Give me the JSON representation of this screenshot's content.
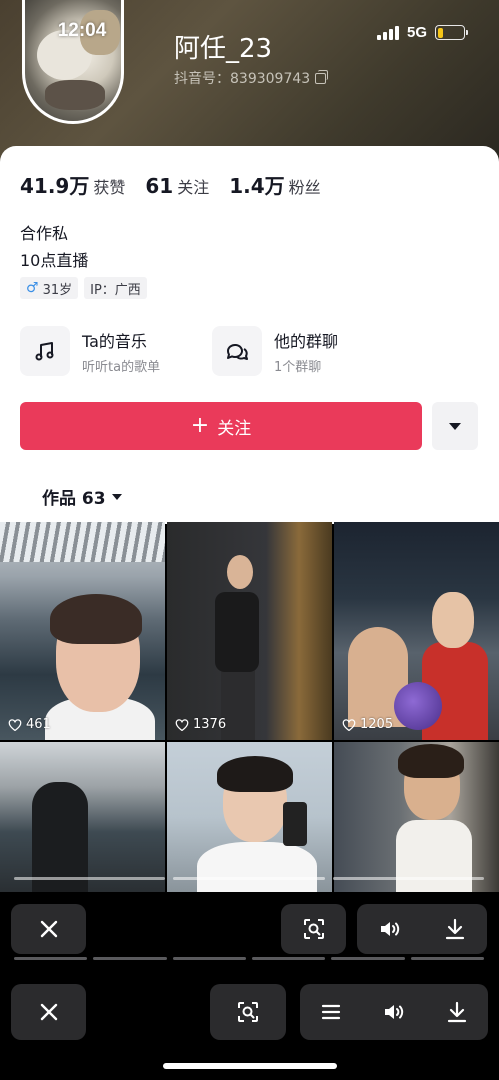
{
  "status_bar": {
    "time": "12:04",
    "network": "5G",
    "battery_level": 0.2
  },
  "profile": {
    "username": "阿任_23",
    "douyin_id": "抖音号：839309743",
    "stats": [
      {
        "value": "41.9万",
        "label": "获赞"
      },
      {
        "value": "61",
        "label": "关注"
      },
      {
        "value": "1.4万",
        "label": "粉丝"
      }
    ],
    "bio_lines": [
      "合作私",
      "10点直播"
    ],
    "tags": {
      "age": "31岁",
      "ip": "IP：广西",
      "gender_icon": "male-icon"
    }
  },
  "features": [
    {
      "title": "Ta的音乐",
      "subtitle": "听听ta的歌单",
      "icon": "music-note-icon"
    },
    {
      "title": "他的群聊",
      "subtitle": "1个群聊",
      "icon": "group-chat-icon"
    }
  ],
  "actions": {
    "follow_label": "关注",
    "follow_icon": "plus-icon",
    "more_icon": "triangle-down-icon"
  },
  "works_tab": {
    "label": "作品 63"
  },
  "videos": [
    {
      "likes": "461"
    },
    {
      "likes": "1376"
    },
    {
      "likes": "1205"
    },
    {
      "likes": ""
    },
    {
      "likes": ""
    },
    {
      "likes": ""
    }
  ],
  "colors": {
    "follow_button": "#ea3a5a",
    "battery": "#f5c518",
    "toolbar_button": "#2b2b2d"
  },
  "toolbar_top": {
    "buttons": [
      "close-icon",
      "scan-icon",
      "volume-icon",
      "download-icon"
    ]
  },
  "toolbar_bottom": {
    "buttons": [
      "close-icon",
      "scan-icon",
      "menu-icon",
      "volume-icon",
      "download-icon"
    ]
  }
}
